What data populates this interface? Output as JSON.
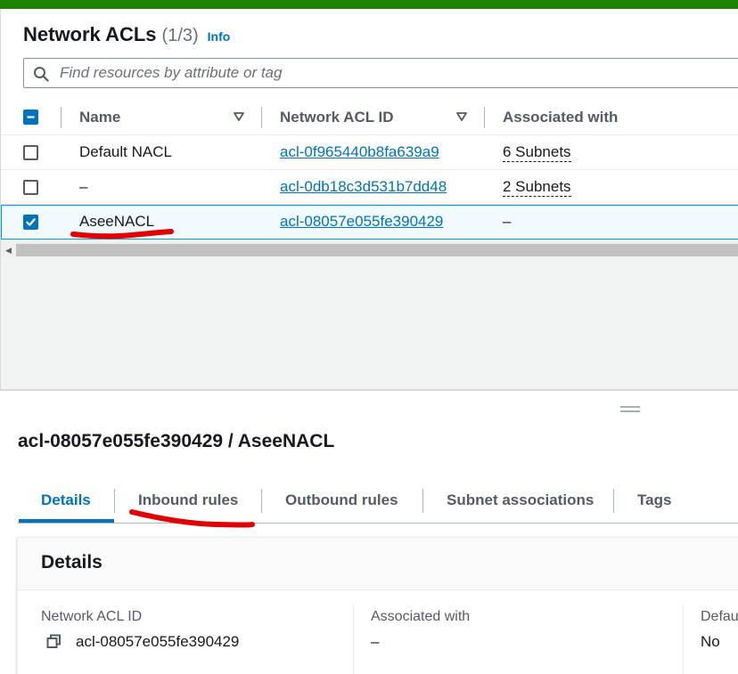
{
  "colors": {
    "accent": "#0073bb",
    "top_bar": "#1d8102",
    "selected_row_bg": "#f1faff",
    "annotation": "#e00000"
  },
  "header": {
    "title": "Network ACLs",
    "count": "(1/3)",
    "info_link": "Info"
  },
  "search": {
    "placeholder": "Find resources by attribute or tag",
    "icon": "search-icon"
  },
  "table": {
    "columns": [
      "Name",
      "Network ACL ID",
      "Associated with"
    ],
    "select_all_state": "indeterminate",
    "rows": [
      {
        "selected": false,
        "name": "Default NACL",
        "acl_id": "acl-0f965440b8fa639a9",
        "associated": "6 Subnets"
      },
      {
        "selected": false,
        "name": "–",
        "acl_id": "acl-0db18c3d531b7dd48",
        "associated": "2 Subnets"
      },
      {
        "selected": true,
        "name": "AseeNACL",
        "acl_id": "acl-08057e055fe390429",
        "associated": "–"
      }
    ]
  },
  "detail": {
    "title": "acl-08057e055fe390429 / AseeNACL",
    "tabs": [
      "Details",
      "Inbound rules",
      "Outbound rules",
      "Subnet associations",
      "Tags"
    ],
    "active_tab": "Details",
    "card_title": "Details",
    "fields": [
      {
        "label": "Network ACL ID",
        "value": "acl-08057e055fe390429"
      },
      {
        "label": "Associated with",
        "value": "–"
      },
      {
        "label": "Defau",
        "value": "No"
      }
    ]
  }
}
